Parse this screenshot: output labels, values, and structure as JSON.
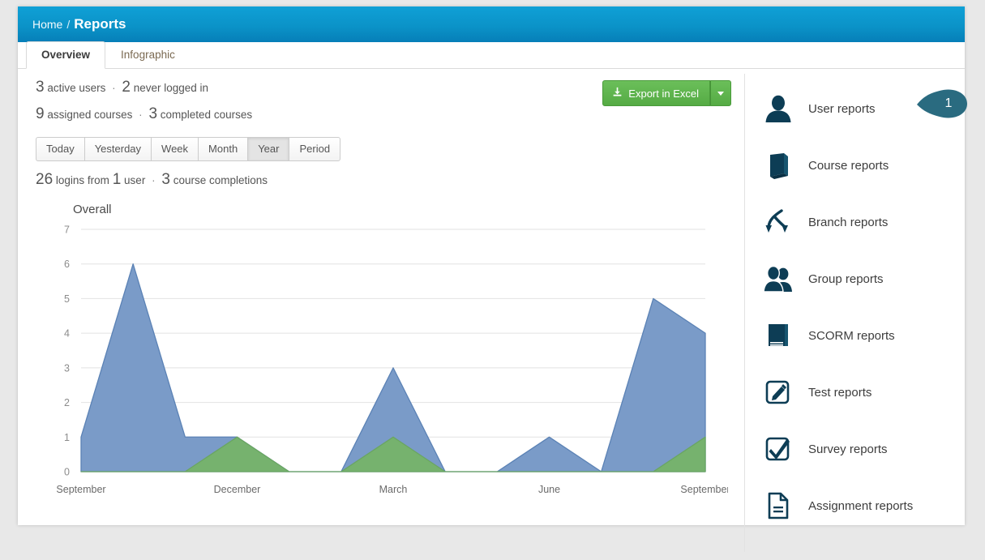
{
  "header": {
    "breadcrumb_home": "Home",
    "breadcrumb_sep": "/",
    "breadcrumb_current": "Reports",
    "gradient_top": "#0fa0d6",
    "gradient_bottom": "#067fb8"
  },
  "tabs": [
    {
      "label": "Overview",
      "active": true
    },
    {
      "label": "Infographic",
      "active": false
    }
  ],
  "stats": {
    "line1": {
      "n1": "3",
      "t1": "active users",
      "sep": "·",
      "n2": "2",
      "t2": "never logged in"
    },
    "line2": {
      "n1": "9",
      "t1": "assigned courses",
      "sep": "·",
      "n2": "3",
      "t2": "completed courses"
    },
    "line3": {
      "n1": "26",
      "t1": "logins from",
      "n2": "1",
      "t2": "user",
      "sep": "·",
      "n3": "3",
      "t3": "course completions"
    }
  },
  "export": {
    "label": "Export in Excel",
    "icon": "download-icon",
    "caret": "chevron-down-icon",
    "color": "#55ab44"
  },
  "period_filter": {
    "options": [
      "Today",
      "Yesterday",
      "Week",
      "Month",
      "Year",
      "Period"
    ],
    "selected": "Year"
  },
  "chart_data": {
    "type": "area",
    "title": "Overall",
    "xlabel": "",
    "ylabel": "",
    "ylim": [
      0,
      7
    ],
    "yticks": [
      0,
      1,
      2,
      3,
      4,
      5,
      6,
      7
    ],
    "grid": true,
    "legend": "none",
    "x": [
      "September",
      "October",
      "November",
      "December",
      "January",
      "February",
      "March",
      "April",
      "May",
      "June",
      "July",
      "August",
      "September"
    ],
    "tick_labels": [
      "September",
      "December",
      "March",
      "June",
      "September"
    ],
    "tick_indices": [
      0,
      3,
      6,
      9,
      12
    ],
    "series": [
      {
        "name": "Logins",
        "color": "#7a9bc8",
        "stroke": "#5b82b5",
        "values": [
          1,
          6,
          1,
          1,
          0,
          0,
          3,
          0,
          0,
          1,
          0,
          5,
          4
        ]
      },
      {
        "name": "Course completions",
        "color": "#76b26e",
        "stroke": "#6aa562",
        "values": [
          0,
          0,
          0,
          1,
          0,
          0,
          1,
          0,
          0,
          0,
          0,
          0,
          1
        ]
      }
    ]
  },
  "sidebar": {
    "items": [
      {
        "label": "User reports",
        "icon": "user-icon",
        "badge": "1"
      },
      {
        "label": "Course reports",
        "icon": "book-icon"
      },
      {
        "label": "Branch reports",
        "icon": "branch-icon"
      },
      {
        "label": "Group reports",
        "icon": "group-icon"
      },
      {
        "label": "SCORM reports",
        "icon": "scorm-book-icon"
      },
      {
        "label": "Test reports",
        "icon": "pencil-square-icon"
      },
      {
        "label": "Survey reports",
        "icon": "check-square-icon"
      },
      {
        "label": "Assignment reports",
        "icon": "document-icon"
      }
    ],
    "icon_color": "#0d3d55",
    "badge_color": "#2a6b80"
  }
}
